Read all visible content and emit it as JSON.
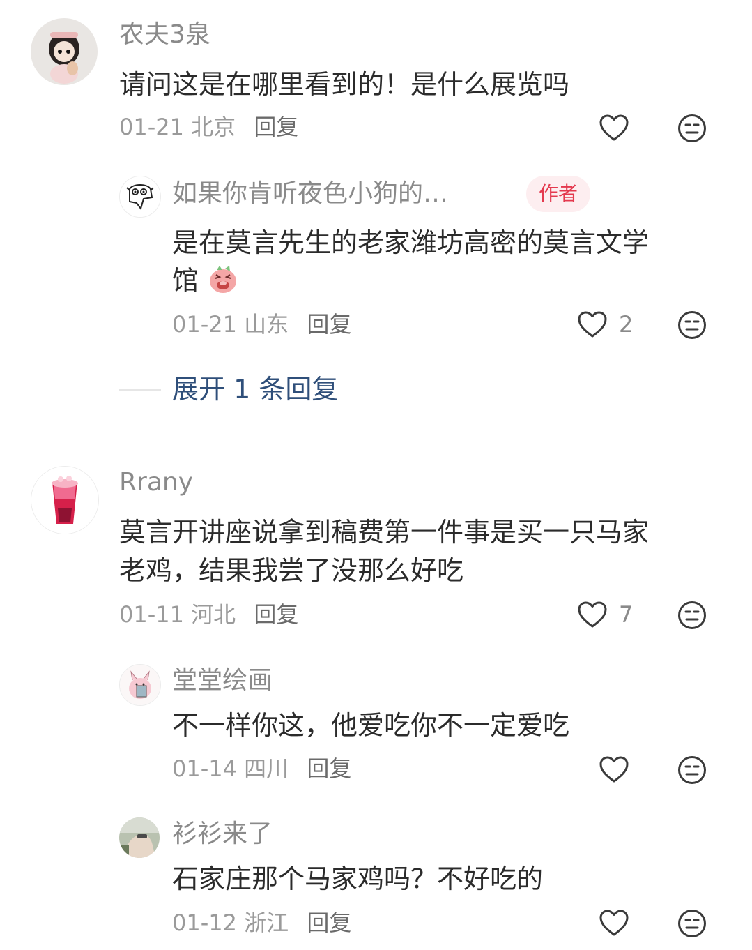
{
  "comments": [
    {
      "username": "农夫3泉",
      "text_lines": [
        "请问这是在哪里看到的！是什么展览吗"
      ],
      "date": "01-21",
      "location": "北京",
      "reply_label": "回复",
      "likes": "",
      "replies": [
        {
          "username": "如果你肯听夜色小狗的…",
          "badge": "作者",
          "text_lines": [
            "是在莫言先生的老家潍坊高密的莫言文学",
            "馆"
          ],
          "date": "01-21",
          "location": "山东",
          "reply_label": "回复",
          "likes": "2"
        }
      ],
      "expand_label": "展开 1 条回复"
    },
    {
      "username": "Rrany",
      "text_lines": [
        "莫言开讲座说拿到稿费第一件事是买一只马家",
        "老鸡，结果我尝了没那么好吃"
      ],
      "date": "01-11",
      "location": "河北",
      "reply_label": "回复",
      "likes": "7",
      "replies": [
        {
          "username": "堂堂绘画",
          "text_lines": [
            "不一样你这，他爱吃你不一定爱吃"
          ],
          "date": "01-14",
          "location": "四川",
          "reply_label": "回复",
          "likes": ""
        },
        {
          "username": "衫衫来了",
          "text_lines": [
            "石家庄那个马家鸡吗？不好吃的"
          ],
          "date": "01-12",
          "location": "浙江",
          "reply_label": "回复",
          "likes": ""
        }
      ]
    }
  ],
  "icons": {
    "like": "heart-outline-icon",
    "dislike": "meh-face-icon"
  },
  "colors": {
    "accent_badge": "#e4394e",
    "expand_link": "#2f4f7a"
  }
}
